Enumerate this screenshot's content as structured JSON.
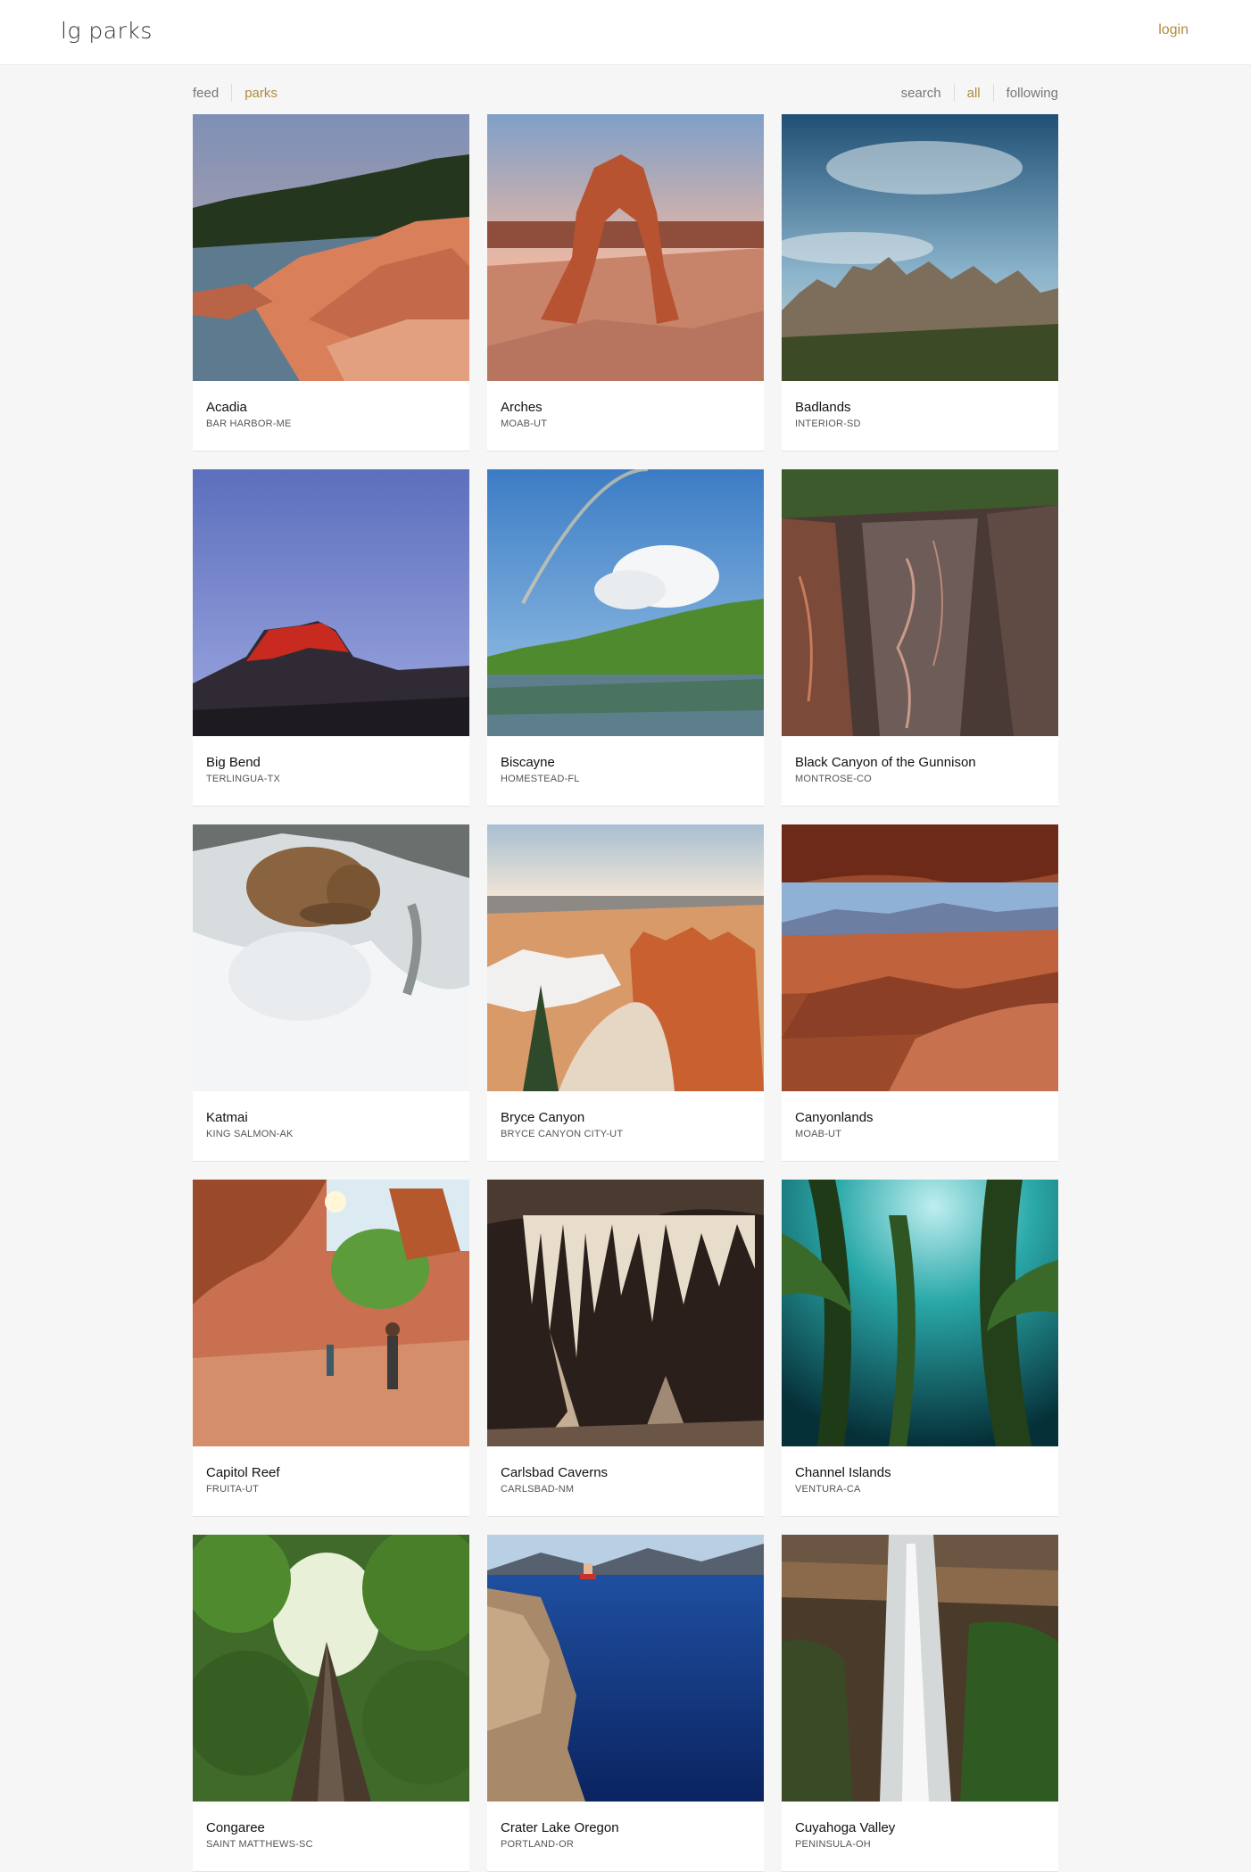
{
  "header": {
    "logo": "lg parks",
    "login_label": "login",
    "accent_color": "#b08b3c"
  },
  "subnav": {
    "left": [
      {
        "label": "feed",
        "active": false
      },
      {
        "label": "parks",
        "active": true
      }
    ],
    "right": [
      {
        "label": "search",
        "active": false
      },
      {
        "label": "all",
        "active": true
      },
      {
        "label": "following",
        "active": false
      }
    ]
  },
  "parks": [
    {
      "name": "Acadia",
      "location": "BAR HARBOR-ME",
      "photo": "rocky-coast-photo"
    },
    {
      "name": "Arches",
      "location": "MOAB-UT",
      "photo": "delicate-arch-photo"
    },
    {
      "name": "Badlands",
      "location": "INTERIOR-SD",
      "photo": "badlands-ridge-photo"
    },
    {
      "name": "Big Bend",
      "location": "TERLINGUA-TX",
      "photo": "red-mesa-photo"
    },
    {
      "name": "Biscayne",
      "location": "HOMESTEAD-FL",
      "photo": "mangrove-rainbow-photo"
    },
    {
      "name": "Black Canyon of the Gunnison",
      "location": "MONTROSE-CO",
      "photo": "canyon-wall-photo"
    },
    {
      "name": "Katmai",
      "location": "KING SALMON-AK",
      "photo": "bear-waterfall-photo"
    },
    {
      "name": "Bryce Canyon",
      "location": "BRYCE CANYON CITY-UT",
      "photo": "hoodoos-snow-photo"
    },
    {
      "name": "Canyonlands",
      "location": "MOAB-UT",
      "photo": "mesa-arch-view-photo"
    },
    {
      "name": "Capitol Reef",
      "location": "FRUITA-UT",
      "photo": "slot-canyon-hikers-photo"
    },
    {
      "name": "Carlsbad Caverns",
      "location": "CARLSBAD-NM",
      "photo": "cave-formations-photo"
    },
    {
      "name": "Channel Islands",
      "location": "VENTURA-CA",
      "photo": "kelp-forest-photo"
    },
    {
      "name": "Congaree",
      "location": "SAINT MATTHEWS-SC",
      "photo": "tall-tree-photo"
    },
    {
      "name": "Crater Lake Oregon",
      "location": "PORTLAND-OR",
      "photo": "cliff-jump-lake-photo"
    },
    {
      "name": "Cuyahoga Valley",
      "location": "PENINSULA-OH",
      "photo": "waterfall-photo"
    }
  ]
}
